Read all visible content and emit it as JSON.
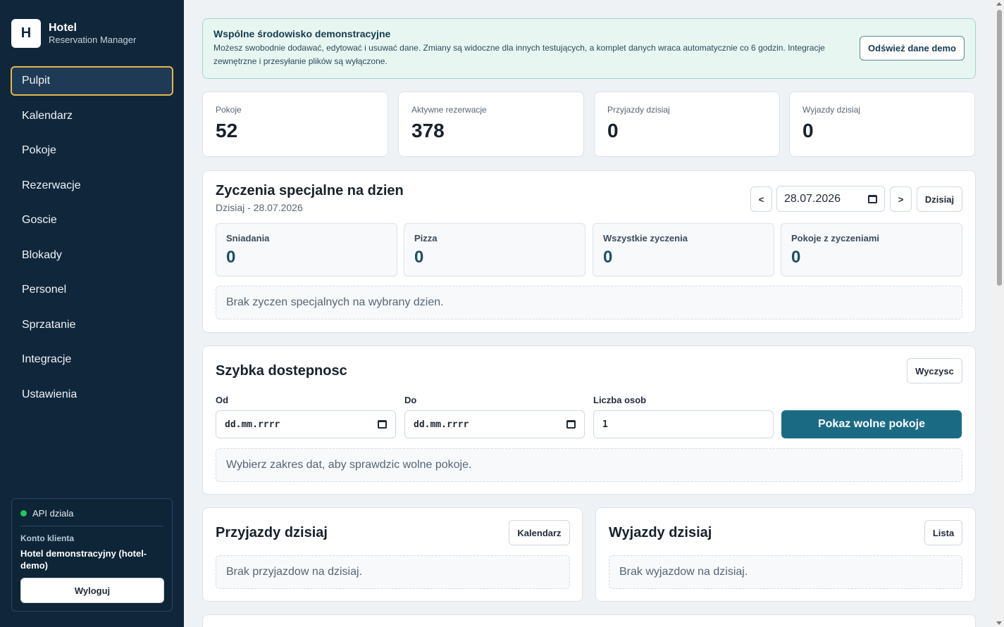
{
  "brand": {
    "logo_letter": "H",
    "title": "Hotel",
    "subtitle": "Reservation Manager"
  },
  "nav": [
    {
      "label": "Pulpit",
      "active": true
    },
    {
      "label": "Kalendarz"
    },
    {
      "label": "Pokoje"
    },
    {
      "label": "Rezerwacje"
    },
    {
      "label": "Goscie"
    },
    {
      "label": "Blokady"
    },
    {
      "label": "Personel"
    },
    {
      "label": "Sprzatanie"
    },
    {
      "label": "Integracje"
    },
    {
      "label": "Ustawienia"
    }
  ],
  "account": {
    "api_status": "API dziala",
    "api_color": "#22c55e",
    "label": "Konto klienta",
    "name": "Hotel demonstracyjny (hotel-demo)",
    "logout": "Wyloguj"
  },
  "banner": {
    "title": "Wspólne środowisko demonstracyjne",
    "text": "Możesz swobodnie dodawać, edytować i usuwać dane. Zmiany są widoczne dla innych testujących, a komplet danych wraca automatycznie co 6 godzin. Integracje zewnętrzne i przesyłanie plików są wyłączone.",
    "button": "Odśwież dane demo"
  },
  "stats": [
    {
      "label": "Pokoje",
      "value": "52"
    },
    {
      "label": "Aktywne rezerwacje",
      "value": "378"
    },
    {
      "label": "Przyjazdy dzisiaj",
      "value": "0"
    },
    {
      "label": "Wyjazdy dzisiaj",
      "value": "0"
    }
  ],
  "wishes": {
    "title": "Zyczenia specjalne na dzien",
    "subtitle": "Dzisiaj - 28.07.2026",
    "prev": "<",
    "next": ">",
    "date": "28.07.2026",
    "today_btn": "Dzisiaj",
    "cards": [
      {
        "label": "Sniadania",
        "value": "0"
      },
      {
        "label": "Pizza",
        "value": "0"
      },
      {
        "label": "Wszystkie zyczenia",
        "value": "0"
      },
      {
        "label": "Pokoje z zyczeniami",
        "value": "0"
      }
    ],
    "empty": "Brak zyczen specjalnych na wybrany dzien."
  },
  "availability": {
    "title": "Szybka dostepnosc",
    "clear_btn": "Wyczysc",
    "from_label": "Od",
    "to_label": "Do",
    "guests_label": "Liczba osob",
    "from_placeholder": "dd.mm.rrrr",
    "to_placeholder": "dd.mm.rrrr",
    "guests_value": "1",
    "submit": "Pokaz wolne pokoje",
    "empty": "Wybierz zakres dat, aby sprawdzic wolne pokoje."
  },
  "arrivals": {
    "title": "Przyjazdy dzisiaj",
    "button": "Kalendarz",
    "empty": "Brak przyjazdow na dzisiaj."
  },
  "departures": {
    "title": "Wyjazdy dzisiaj",
    "button": "Lista",
    "empty": "Brak wyjazdow na dzisiaj."
  }
}
